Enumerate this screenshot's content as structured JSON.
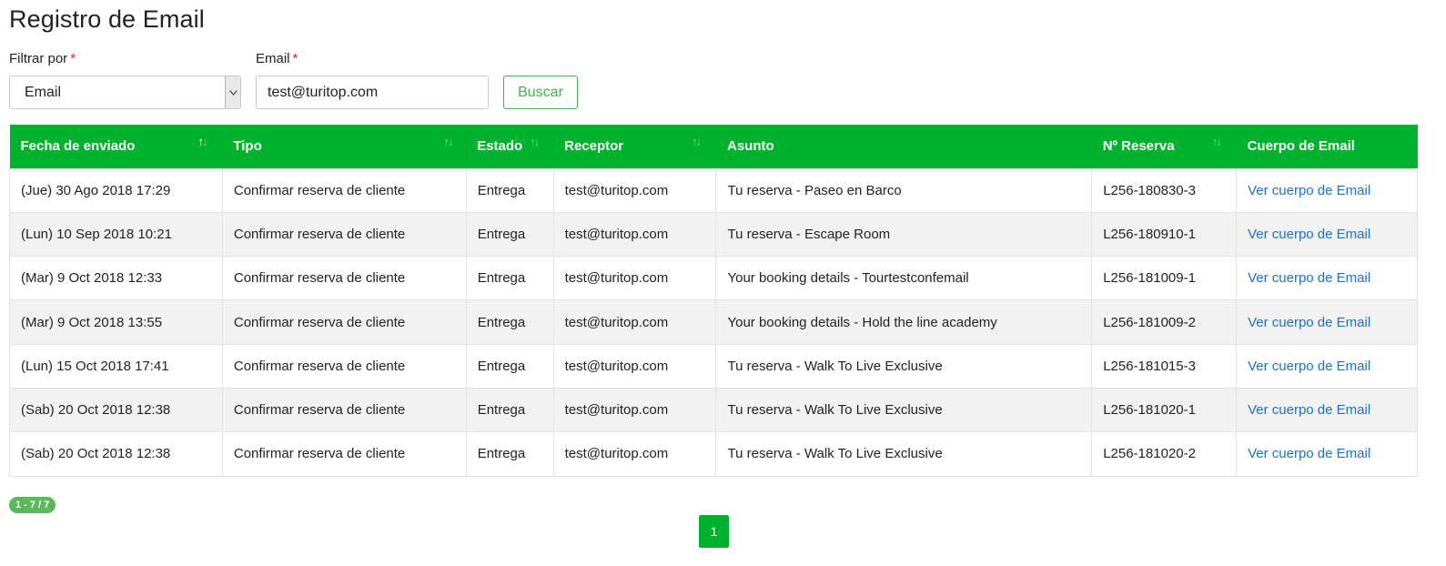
{
  "page": {
    "title": "Registro de Email"
  },
  "filters": {
    "filter_label": "Filtrar por",
    "filter_required": "*",
    "filter_value": "Email",
    "email_label": "Email",
    "email_required": "*",
    "email_value": "test@turitop.com",
    "search_label": "Buscar"
  },
  "table": {
    "headers": [
      "Fecha de enviado",
      "Tipo",
      "Estado",
      "Receptor",
      "Asunto",
      "Nº Reserva",
      "Cuerpo de Email"
    ],
    "rows": [
      [
        "(Jue) 30 Ago 2018 17:29",
        "Confirmar reserva de cliente",
        "Entrega",
        "test@turitop.com",
        "Tu reserva - Paseo en Barco",
        "L256-180830-3",
        "Ver cuerpo de Email"
      ],
      [
        "(Lun) 10 Sep 2018 10:21",
        "Confirmar reserva de cliente",
        "Entrega",
        "test@turitop.com",
        "Tu reserva - Escape Room",
        "L256-180910-1",
        "Ver cuerpo de Email"
      ],
      [
        "(Mar) 9 Oct 2018 12:33",
        "Confirmar reserva de cliente",
        "Entrega",
        "test@turitop.com",
        "Your booking details - Tourtestconfemail",
        "L256-181009-1",
        "Ver cuerpo de Email"
      ],
      [
        "(Mar) 9 Oct 2018 13:55",
        "Confirmar reserva de cliente",
        "Entrega",
        "test@turitop.com",
        "Your booking details - Hold the line academy",
        "L256-181009-2",
        "Ver cuerpo de Email"
      ],
      [
        "(Lun) 15 Oct 2018 17:41",
        "Confirmar reserva de cliente",
        "Entrega",
        "test@turitop.com",
        "Tu reserva - Walk To Live Exclusive",
        "L256-181015-3",
        "Ver cuerpo de Email"
      ],
      [
        "(Sab) 20 Oct 2018 12:38",
        "Confirmar reserva de cliente",
        "Entrega",
        "test@turitop.com",
        "Tu reserva - Walk To Live Exclusive",
        "L256-181020-1",
        "Ver cuerpo de Email"
      ],
      [
        "(Sab) 20 Oct 2018 12:38",
        "Confirmar reserva de cliente",
        "Entrega",
        "test@turitop.com",
        "Tu reserva - Walk To Live Exclusive",
        "L256-181020-2",
        "Ver cuerpo de Email"
      ]
    ]
  },
  "pagination": {
    "count_text": "1 - 7 / 7",
    "current_page": "1"
  },
  "icons": {
    "sort": "sort-arrows-icon",
    "select_arrow": "chevron-down-icon"
  },
  "colors": {
    "header_green": "#00b22d",
    "link_blue": "#1a73c9",
    "required_red": "#e02020",
    "button_green": "#3ab54a"
  }
}
